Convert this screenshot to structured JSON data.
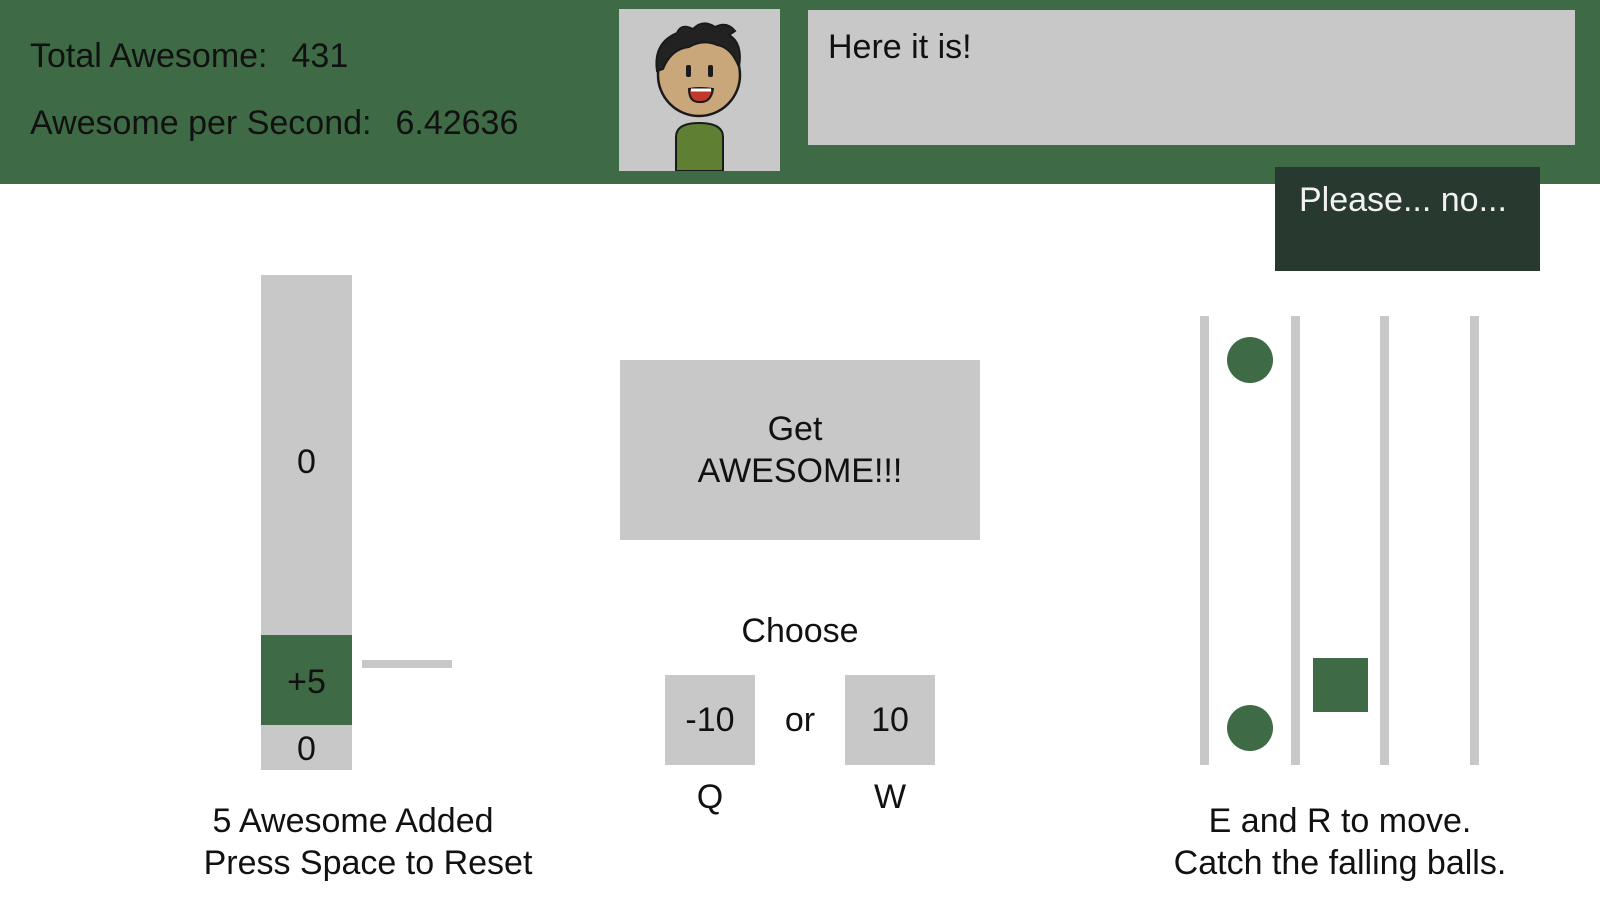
{
  "stats": {
    "total_label": "Total Awesome:",
    "total_value": "431",
    "aps_label": "Awesome per Second:",
    "aps_value": "6.42636"
  },
  "character": {
    "icon": "cartoon-character-portrait"
  },
  "dialog": {
    "message": "Here it is!",
    "reply": "Please... no..."
  },
  "meter": {
    "top_value": "0",
    "fill_label": "+5",
    "bottom_value": "0",
    "caption_line1": "5 Awesome Added",
    "caption_line2": "Press Space to Reset"
  },
  "main_button": {
    "line1": "Get",
    "line2": "AWESOME!!!"
  },
  "choice": {
    "prompt": "Choose",
    "option_q_value": "-10",
    "or_text": "or",
    "option_w_value": "10",
    "key_q": "Q",
    "key_w": "W"
  },
  "minigame": {
    "caption_line1": "E and R to move.",
    "caption_line2": "Catch the falling balls."
  },
  "colors": {
    "header_green": "#3e6b45",
    "panel_gray": "#c8c8c8",
    "reply_dark": "#283a2f",
    "shirt_green": "#5f7f32"
  }
}
